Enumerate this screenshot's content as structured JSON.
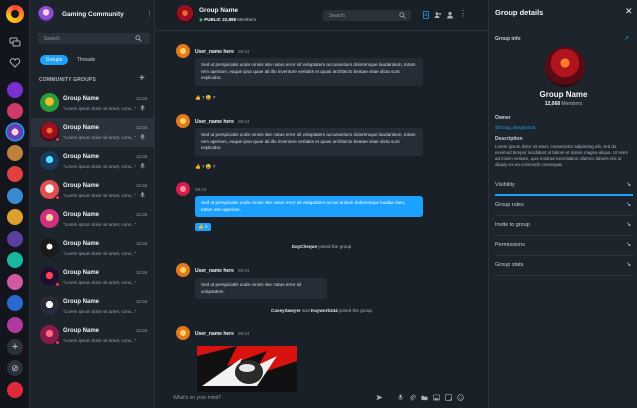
{
  "community": {
    "title": "Gaming Community",
    "search_placeholder": "Search",
    "tabs": [
      "Groups",
      "Threads"
    ],
    "section_label": "COMMUNITY GROUPS",
    "groups": [
      {
        "name": "Group Name",
        "preview": "\"Lorem ipsum dolor sit amet, cons...\"",
        "time": "12:34",
        "icon": "mic-icon"
      },
      {
        "name": "Group Name",
        "preview": "\"Lorem ipsum dolor sit amet, cons...\"",
        "time": "12:34",
        "icon": "mic-icon"
      },
      {
        "name": "Group Name",
        "preview": "\"Lorem ipsum dolor sit amet, cons...\"",
        "time": "12:34",
        "icon": "mic-icon"
      },
      {
        "name": "Group Name",
        "preview": "\"Lorem ipsum dolor sit amet, cons...\"",
        "time": "12:34",
        "icon": "mic-icon"
      },
      {
        "name": "Group Name",
        "preview": "\"Lorem ipsum dolor sit amet, cons...\"",
        "time": "12:34",
        "icon": ""
      },
      {
        "name": "Group Name",
        "preview": "\"Lorem ipsum dolor sit amet, cons...\"",
        "time": "12:34",
        "icon": ""
      },
      {
        "name": "Group Name",
        "preview": "\"Lorem ipsum dolor sit amet, cons...\"",
        "time": "12:34",
        "icon": ""
      },
      {
        "name": "Group Name",
        "preview": "\"Lorem ipsum dolor sit amet, cons...\"",
        "time": "12:34",
        "icon": ""
      },
      {
        "name": "Group Name",
        "preview": "\"Lorem ipsum dolor sit amet, cons...\"",
        "time": "12:34",
        "icon": ""
      }
    ]
  },
  "chat": {
    "title": "Group Name",
    "visibility": "PUBLIC",
    "members_count": "22,868",
    "members_label": "Members",
    "search_placeholder": "Search",
    "messages": [
      {
        "user": "User_name here",
        "time": "09:24",
        "text": "Sed ut perspiciatis unde omnis iste natus error sit voluptatem accusantium doloremque laudantium, totam rem aperiam, eaque ipsa quae ab illo inventore veritatis et quasi architecto beatae vitae dicta sunt explicabo.",
        "reactions": "👍 7  😄 7"
      },
      {
        "user": "User_name here",
        "time": "09:24",
        "text": "Sed ut perspiciatis unde omnis iste natus error sit voluptatem accusantium doloremque laudantium, totam rem aperiam, eaque ipsa quae ab illo inventore veritatis et quasi architecto beatae vitae dicta sunt explicabo.",
        "reactions": "👍 7  😄 7"
      },
      {
        "time": "09:24",
        "text": "Sed ut perspiciatis unde omnis iste natus error sit voluptatem accus antium doloremque laudan tium, totam rem aperiam.",
        "reactions": "👍 2"
      },
      {
        "user": "User_name here",
        "time": "09:24",
        "text": "Sed ut perspiciatis unde omnis iste natus error sit voluptatem."
      },
      {
        "user": "User_name here",
        "time": "09:24"
      }
    ],
    "system_1": {
      "name": "DayCheque",
      "text": "joined the group"
    },
    "system_2": {
      "name1": "CaseySawyer",
      "and": "and",
      "name2": "Kaywork344",
      "text": "joined the group"
    },
    "composer_placeholder": "What's on your mind?"
  },
  "details": {
    "title": "Group details",
    "section": "Group info",
    "name": "Group Name",
    "members_count": "12,068",
    "members_label": "Members",
    "owner_label": "Owner",
    "owner": "@Craig_Bergson15",
    "description_label": "Description",
    "description": "Lorem ipsum dolor sit amet, consectetur adipiscing elit, sed do eiusmod tempor incididunt ut labore et dolore magna aliqua. Ut enim ad minim veniam, quis nostrud exercitation ullamco laboris nisi ut aliquip ex ea commodo consequat.",
    "menu": [
      "Visibility",
      "Group rules",
      "Invite to group",
      "Permissions",
      "Group stats"
    ]
  },
  "colors": {
    "accent": "#1da1ff",
    "badge": "#ff2b55",
    "background": "#1b2129"
  }
}
